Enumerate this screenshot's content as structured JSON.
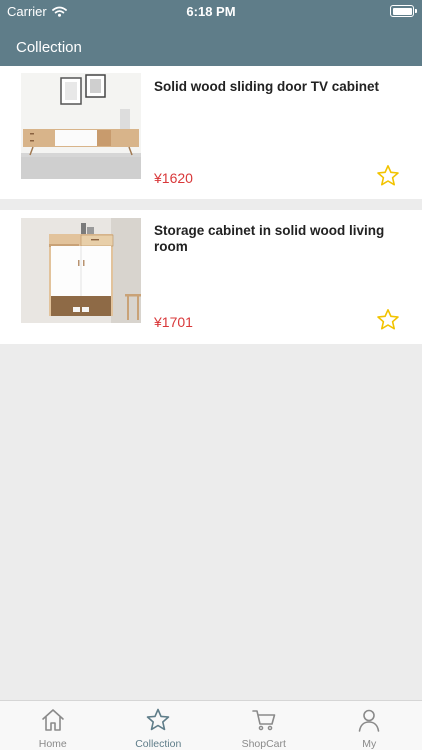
{
  "status": {
    "carrier": "Carrier",
    "time": "6:18 PM"
  },
  "header": {
    "title": "Collection"
  },
  "items": [
    {
      "name": "Solid wood sliding door TV cabinet",
      "price": "¥1620",
      "image": "tv-cabinet-photo",
      "starred": true
    },
    {
      "name": "Storage cabinet in solid wood living room",
      "price": "¥1701",
      "image": "storage-cabinet-photo",
      "starred": true
    }
  ],
  "tabbar": {
    "tabs": [
      {
        "label": "Home",
        "icon": "home-icon"
      },
      {
        "label": "Collection",
        "icon": "star-icon",
        "active": true
      },
      {
        "label": "ShopCart",
        "icon": "cart-icon"
      },
      {
        "label": "My",
        "icon": "person-icon"
      }
    ]
  },
  "colors": {
    "header": "#5f7d89",
    "price": "#d9383a",
    "star": "#f2c300",
    "background": "#ececec"
  }
}
